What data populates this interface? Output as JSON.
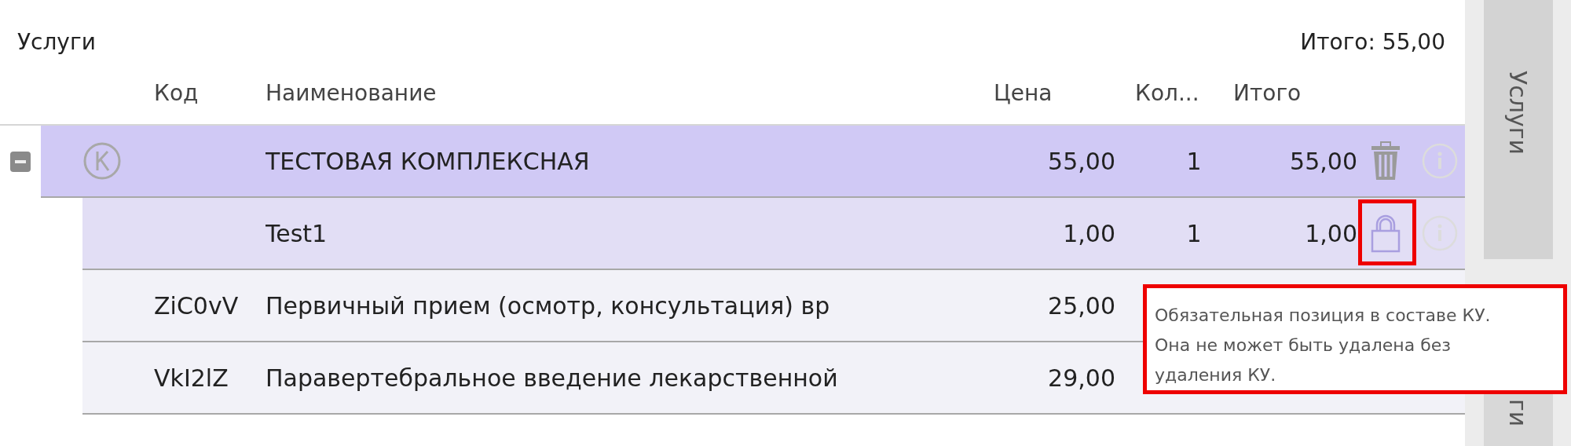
{
  "panel": {
    "title": "Услуги",
    "total": "Итого: 55,00"
  },
  "table": {
    "columns": [
      "Код",
      "Наименование",
      "Цена",
      "Кол...",
      "Итого"
    ],
    "rows": [
      {
        "kind": "complex",
        "expanded": true,
        "name": "ТЕСТОВАЯ КОМПЛЕКСНАЯ",
        "price": "55,00",
        "qty": "1",
        "total": "55,00",
        "deletable": true,
        "children": [
          {
            "kind": "component",
            "name": "Test1",
            "price": "1,00",
            "qty": "1",
            "total": "1,00",
            "locked": true,
            "highlighted": true
          }
        ]
      },
      {
        "kind": "service",
        "code": "ZiC0vV",
        "name": "Первичный прием (осмотр, консультация) вр",
        "price": "25,00"
      },
      {
        "kind": "service",
        "code": "VkI2lZ",
        "name": "Паравертебральное введение лекарственной",
        "price": "29,00"
      }
    ]
  },
  "side_tabs": [
    {
      "label": "Услуги",
      "selected": true
    },
    {
      "label": "ги",
      "selected": false
    }
  ],
  "tooltip": {
    "text": "Обязательная позиция в составе КУ. Она не может быть удалена без удаления КУ."
  }
}
